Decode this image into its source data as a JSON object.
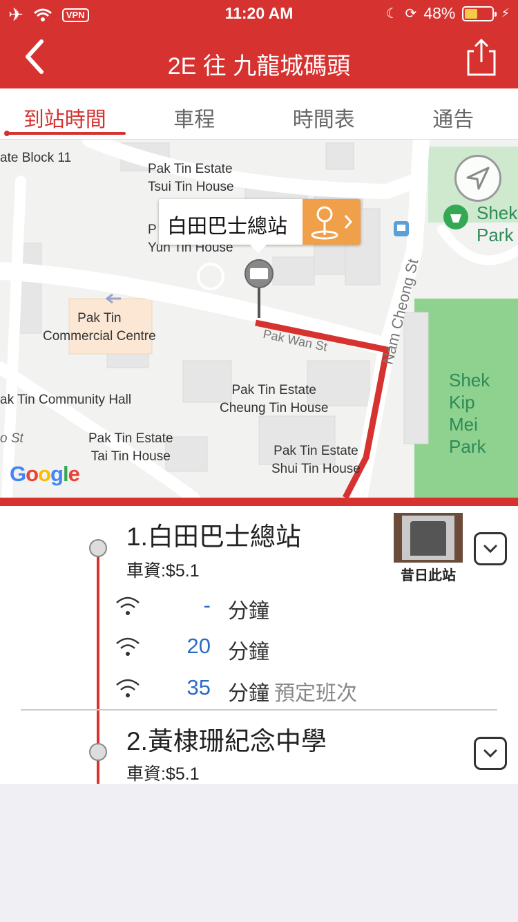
{
  "status": {
    "time": "11:20 AM",
    "vpn": "VPN",
    "battery": "48%",
    "battery_level": 0.48
  },
  "header": {
    "title": "2E 往 九龍城碼頭",
    "back_icon": "chevron-left-icon",
    "share_icon": "share-icon"
  },
  "tabs": [
    {
      "label": "到站時間",
      "active": true
    },
    {
      "label": "車程",
      "active": false
    },
    {
      "label": "時間表",
      "active": false
    },
    {
      "label": "通告",
      "active": false
    }
  ],
  "map": {
    "labels": [
      "ate Block 11",
      "Pak Tin Estate",
      "Tsui Tin House",
      "P",
      "Yun Tin House",
      "Pak Tin",
      "Commercial Centre",
      "Pak Tin Estate",
      "Cheung Tin House",
      "ak Tin Community Hall",
      "Pak Tin Estate",
      "Tai Tin House",
      "Pak Tin Estate",
      "Shui Tin House",
      "Shek",
      "Park",
      "Shek Kip",
      "Mei Park",
      "o St",
      "Pak Wan St",
      "Nam Cheong St"
    ],
    "popup_title": "白田巴士總站",
    "google": "Google"
  },
  "stops": [
    {
      "name": "1.白田巴士總站",
      "fare": "車資:$5.1",
      "thumb_caption": "昔日此站",
      "etas": [
        {
          "value": "-",
          "unit": "分鐘",
          "note": ""
        },
        {
          "value": "20",
          "unit": "分鐘",
          "note": ""
        },
        {
          "value": "35",
          "unit": "分鐘",
          "note": "預定班次"
        }
      ]
    },
    {
      "name": "2.黃棣珊紀念中學",
      "fare": "車資:$5.1"
    }
  ],
  "colors": {
    "primary": "#d63230",
    "eta": "#2d6bc2",
    "accent": "#f0a04b"
  }
}
